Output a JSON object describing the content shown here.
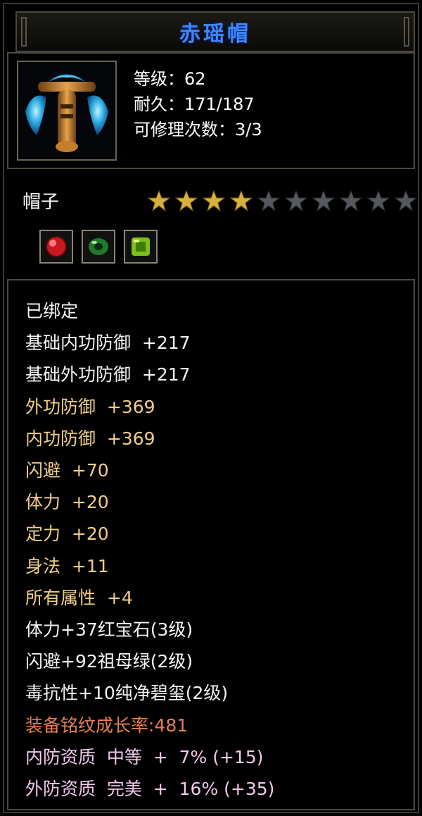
{
  "title": "赤瑶帽",
  "info": {
    "level": "等级：62",
    "durability": "耐久：171/187",
    "repairs": "可修理次数：3/3"
  },
  "item_type": "帽子",
  "stars": {
    "filled": 4,
    "total": 10
  },
  "gems": [
    "red-gem-icon",
    "green-ring-gem-icon",
    "green-square-gem-icon"
  ],
  "colors": {
    "title": "#3d86ff",
    "star_filled": "#d8b040",
    "star_empty": "#55585c",
    "white": "#f4f4f4",
    "yellow": "#f0cf86",
    "orange": "#e87e4e",
    "pink": "#f4c8ea"
  },
  "properties": [
    {
      "text": "已绑定",
      "color": "w"
    },
    {
      "text": "基础内功防御  +217",
      "color": "w"
    },
    {
      "text": "基础外功防御  +217",
      "color": "w"
    },
    {
      "text": "外功防御  +369",
      "color": "y"
    },
    {
      "text": "内功防御  +369",
      "color": "y"
    },
    {
      "text": "闪避  +70",
      "color": "y"
    },
    {
      "text": "体力  +20",
      "color": "y"
    },
    {
      "text": "定力  +20",
      "color": "y"
    },
    {
      "text": "身法  +11",
      "color": "y"
    },
    {
      "text": "所有属性  +4",
      "color": "y"
    },
    {
      "text": "体力+37红宝石(3级)",
      "color": "w"
    },
    {
      "text": "闪避+92祖母绿(2级)",
      "color": "w"
    },
    {
      "text": "毒抗性+10纯净碧玺(2级)",
      "color": "w"
    },
    {
      "text": "装备铭纹成长率:481",
      "color": "o"
    },
    {
      "text": "内防资质  中等  +  7% (+15)",
      "color": "p"
    },
    {
      "text": "外防资质  完美  +  16% (+35)",
      "color": "p"
    }
  ]
}
